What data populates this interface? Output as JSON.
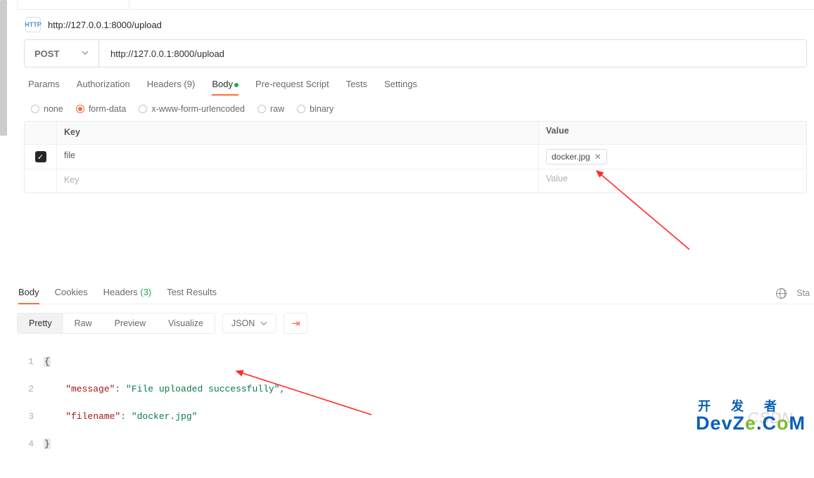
{
  "title_url": "http://127.0.0.1:8000/upload",
  "http_badge": "HTTP",
  "method": "POST",
  "url": "http://127.0.0.1:8000/upload",
  "req_tabs": {
    "params": "Params",
    "auth": "Authorization",
    "headers": "Headers (9)",
    "body": "Body",
    "prereq": "Pre-request Script",
    "tests": "Tests",
    "settings": "Settings"
  },
  "body_types": {
    "none": "none",
    "formdata": "form-data",
    "urlenc": "x-www-form-urlencoded",
    "raw": "raw",
    "binary": "binary"
  },
  "kv": {
    "key_header": "Key",
    "value_header": "Value",
    "row_key": "file",
    "row_file": "docker.jpg",
    "key_placeholder": "Key",
    "value_placeholder": "Value"
  },
  "resp_tabs": {
    "body": "Body",
    "cookies": "Cookies",
    "headers": "Headers ",
    "headers_count": "(3)",
    "test_results": "Test Results"
  },
  "status_right": "Sta",
  "view_modes": {
    "pretty": "Pretty",
    "raw": "Raw",
    "preview": "Preview",
    "visualize": "Visualize"
  },
  "format_dd": "JSON",
  "json": {
    "l1": "{",
    "l2a": "    \"message\"",
    "l2b": ": ",
    "l2c": "\"File uploaded successfully\"",
    "l2d": ",",
    "l3a": "    \"filename\"",
    "l3b": ": ",
    "l3c": "\"docker.jpg\"",
    "l4": "}"
  },
  "line_nums": {
    "n1": "1",
    "n2": "2",
    "n3": "3",
    "n4": "4"
  },
  "watermarks": {
    "csdn": "CSDN",
    "devze_top": "开 发 者",
    "devze_bot1": "DevZ",
    "devze_bot2": "e",
    "devze_bot3": ".C",
    "devze_bot4": "o",
    "devze_bot5": "M"
  }
}
